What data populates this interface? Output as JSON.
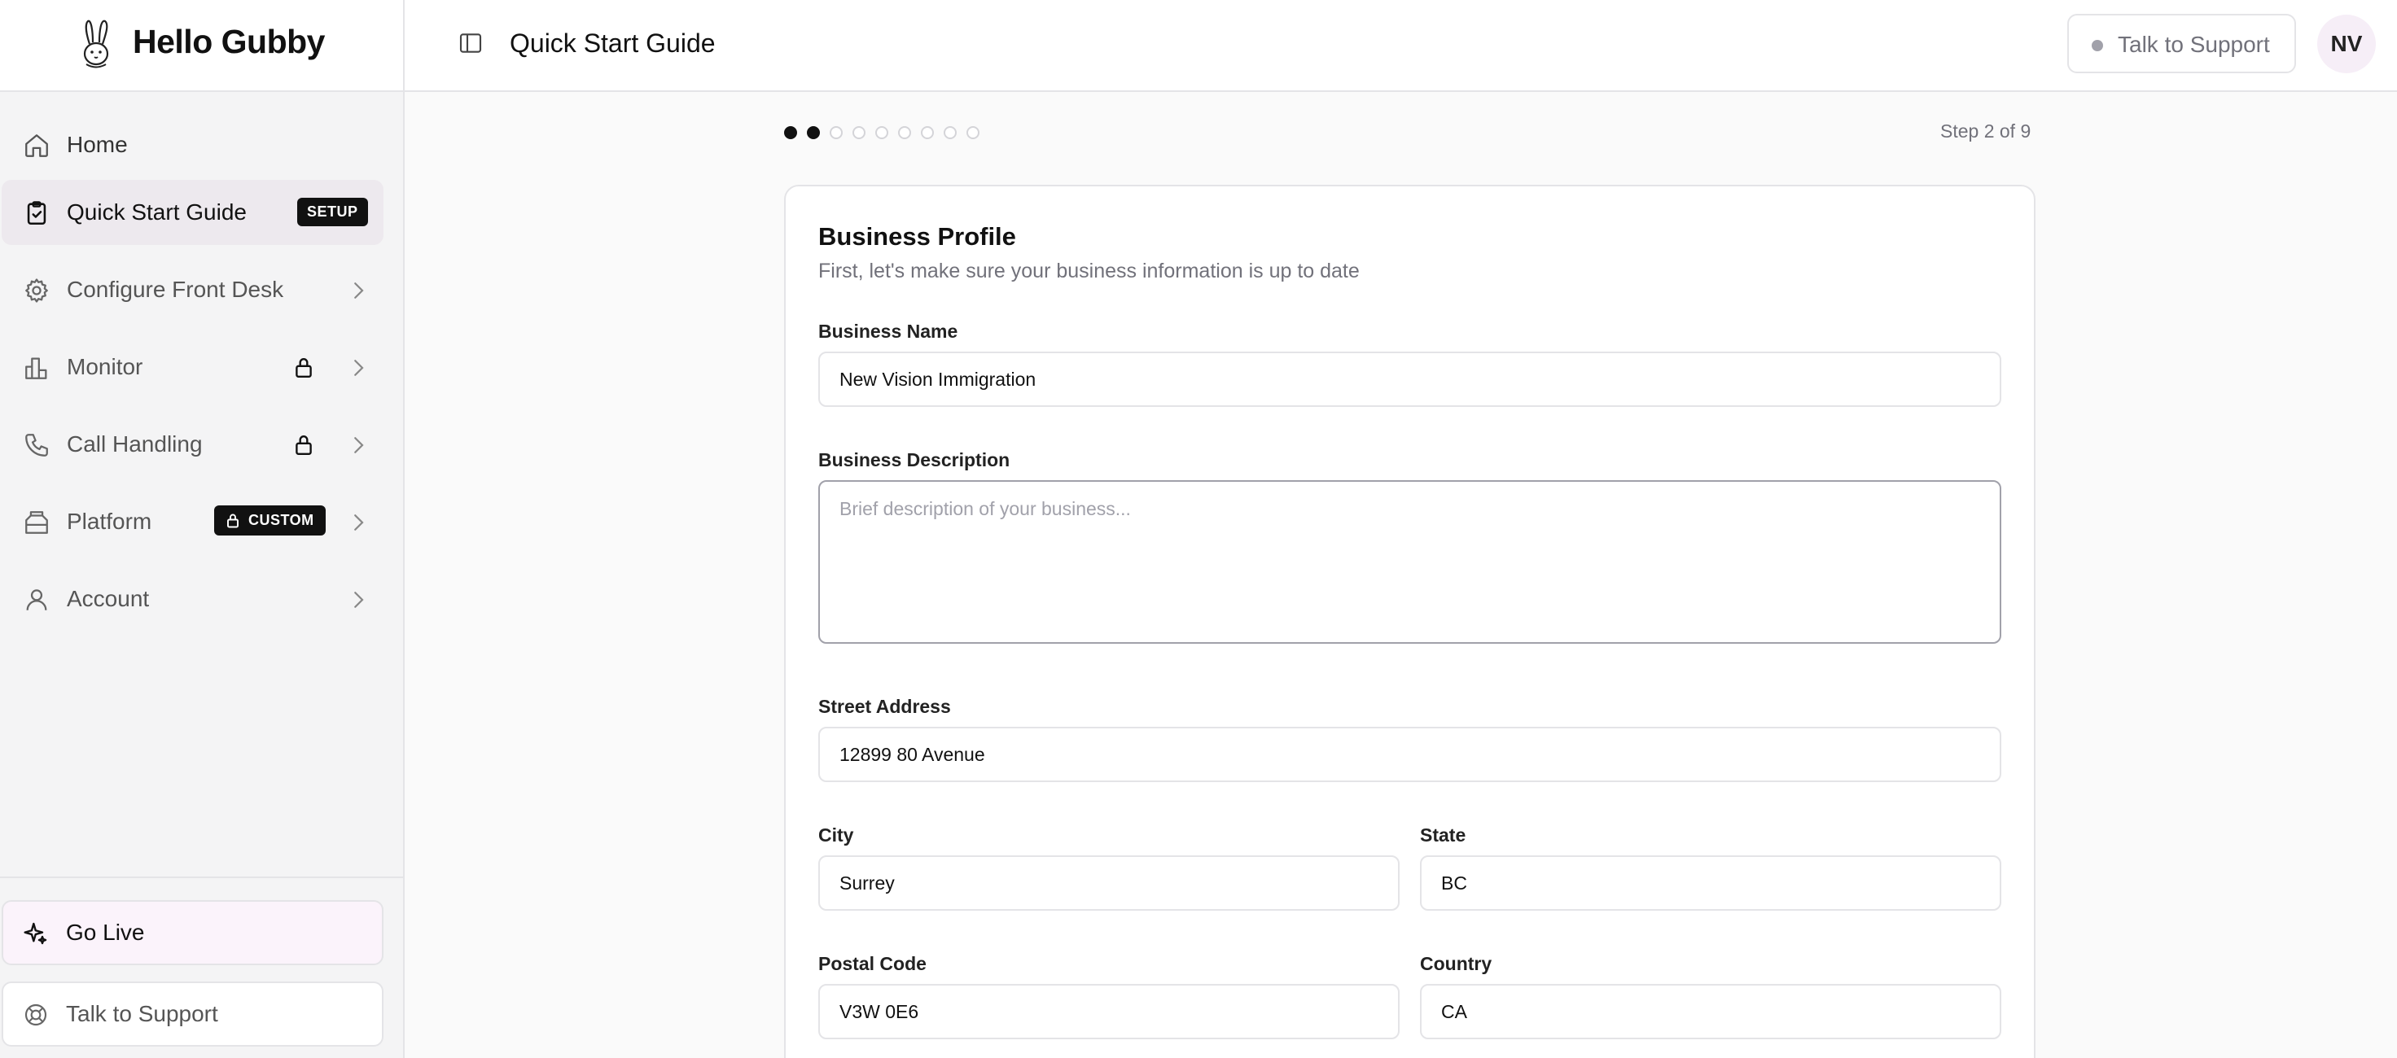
{
  "app": {
    "name": "Hello Gubby"
  },
  "sidebar": {
    "items": [
      {
        "label": "Home",
        "icon": "home-icon"
      },
      {
        "label": "Quick Start Guide",
        "icon": "clipboard-check-icon",
        "badge": "SETUP",
        "active": true
      },
      {
        "label": "Configure Front Desk",
        "icon": "gear-icon"
      },
      {
        "label": "Monitor",
        "icon": "bar-chart-icon",
        "locked": true
      },
      {
        "label": "Call Handling",
        "icon": "phone-icon",
        "locked": true
      },
      {
        "label": "Platform",
        "icon": "building-icon",
        "badge": "CUSTOM"
      },
      {
        "label": "Account",
        "icon": "user-icon"
      }
    ],
    "bottom": {
      "go_live": "Go Live",
      "talk_to_support": "Talk to Support"
    }
  },
  "header": {
    "title": "Quick Start Guide",
    "support_button": "Talk to Support",
    "avatar_initials": "NV"
  },
  "steps": {
    "total": 9,
    "current": 2,
    "label": "Step 2 of 9"
  },
  "form": {
    "title": "Business Profile",
    "subtitle": "First, let's make sure your business information is up to date",
    "business_name": {
      "label": "Business Name",
      "value": "New Vision Immigration"
    },
    "business_description": {
      "label": "Business Description",
      "value": "",
      "placeholder": "Brief description of your business..."
    },
    "street_address": {
      "label": "Street Address",
      "value": "12899 80 Avenue"
    },
    "city": {
      "label": "City",
      "value": "Surrey"
    },
    "state": {
      "label": "State",
      "value": "BC"
    },
    "postal_code": {
      "label": "Postal Code",
      "value": "V3W 0E6"
    },
    "country": {
      "label": "Country",
      "value": "CA"
    }
  },
  "colors": {
    "active_nav_bg": "#ede9ee",
    "badge_bg": "#111111",
    "go_live_bg": "#fbf3fb",
    "avatar_bg": "#f6eef7"
  }
}
